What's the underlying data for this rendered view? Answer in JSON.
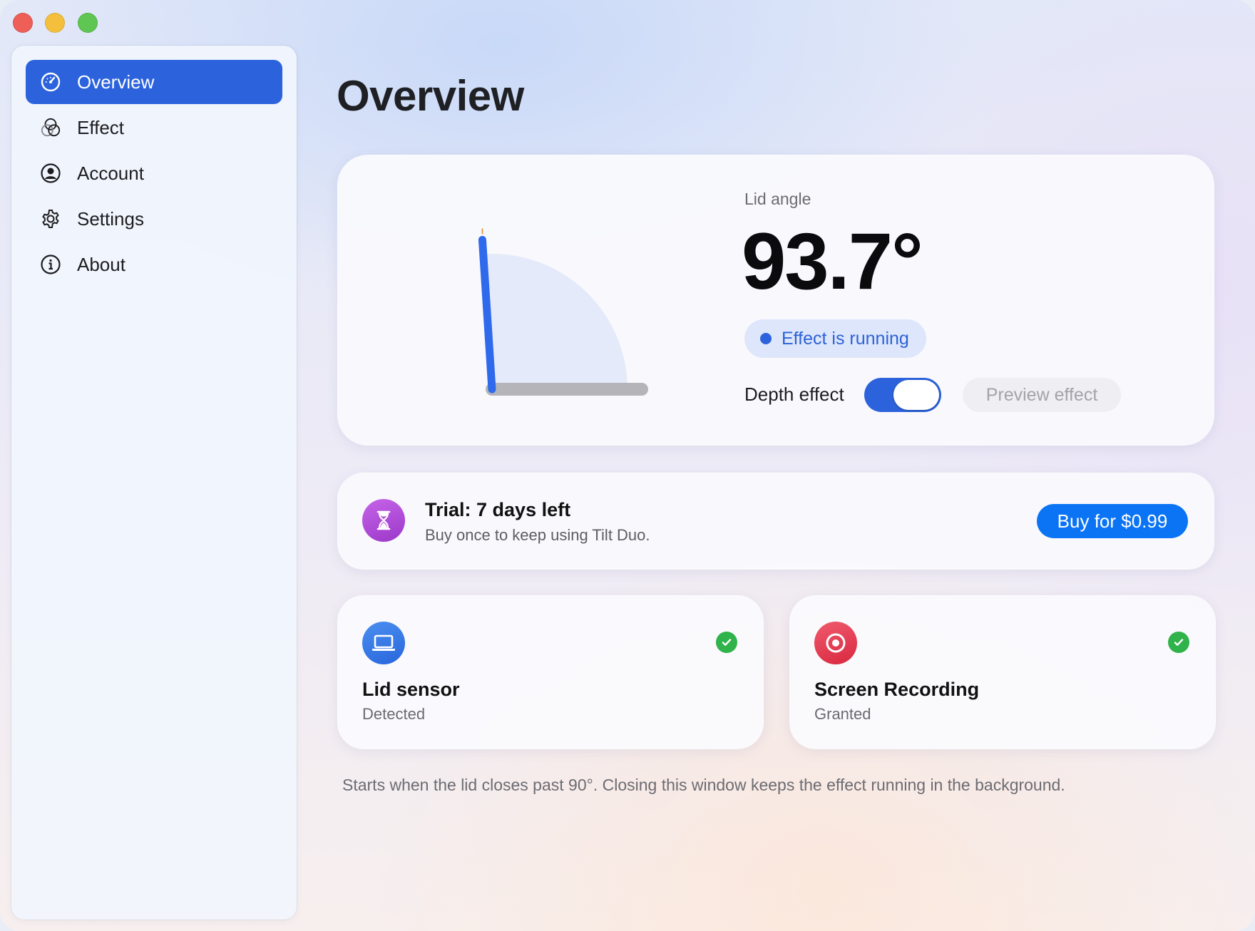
{
  "window": {
    "title": "Overview",
    "controls": [
      "close",
      "minimize",
      "zoom"
    ]
  },
  "sidebar": {
    "items": [
      {
        "label": "Overview",
        "icon": "gauge-icon",
        "active": true
      },
      {
        "label": "Effect",
        "icon": "circles-icon",
        "active": false
      },
      {
        "label": "Account",
        "icon": "person-circle-icon",
        "active": false
      },
      {
        "label": "Settings",
        "icon": "gear-icon",
        "active": false
      },
      {
        "label": "About",
        "icon": "info-icon",
        "active": false
      }
    ]
  },
  "main": {
    "title": "Overview",
    "lid": {
      "label": "Lid angle",
      "value": "93.7°",
      "angle_degrees": 93.7,
      "status": "Effect is running",
      "depth_label": "Depth effect",
      "depth_enabled": true,
      "preview_label": "Preview effect"
    },
    "trial": {
      "title": "Trial: 7 days left",
      "subtitle": "Buy once to keep using Tilt Duo.",
      "buy_label": "Buy for $0.99",
      "icon": "hourglass-icon"
    },
    "permissions": [
      {
        "title": "Lid sensor",
        "status": "Detected",
        "icon": "laptop-icon",
        "ok": true
      },
      {
        "title": "Screen Recording",
        "status": "Granted",
        "icon": "record-icon",
        "ok": true
      }
    ],
    "footnote": "Starts when the lid closes past 90°. Closing this window keeps the effect running in the background."
  },
  "colors": {
    "accent": "#2c63dc",
    "buy_button": "#0b74f5",
    "success": "#2fb34a",
    "trial_icon": "#b24fd9",
    "record_icon": "#e43a50"
  }
}
